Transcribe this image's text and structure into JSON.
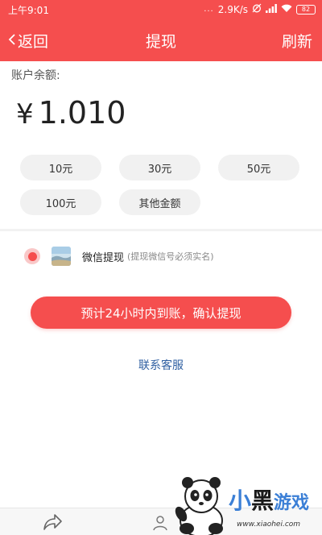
{
  "status_bar": {
    "time": "上午9:01",
    "dots": "...",
    "speed": "2.9K/s",
    "battery": "82"
  },
  "nav": {
    "back_label": "返回",
    "title": "提现",
    "refresh_label": "刷新"
  },
  "balance": {
    "label": "账户余额:",
    "currency_symbol": "¥",
    "amount": "1.010"
  },
  "amount_options": [
    "10元",
    "30元",
    "50元",
    "100元",
    "其他金额"
  ],
  "payment_method": {
    "title": "微信提现",
    "note": "(提现微信号必须实名)"
  },
  "confirm_button": "预计24小时内到账，确认提现",
  "contact_link": "联系客服",
  "watermark": {
    "brand_part1": "小",
    "brand_part2": "黑",
    "brand_part3": "游戏",
    "url": "www.xiaohei.com"
  },
  "colors": {
    "primary": "#f54e4e",
    "link": "#2f5fa1",
    "chip_bg": "#f1f1f1"
  }
}
